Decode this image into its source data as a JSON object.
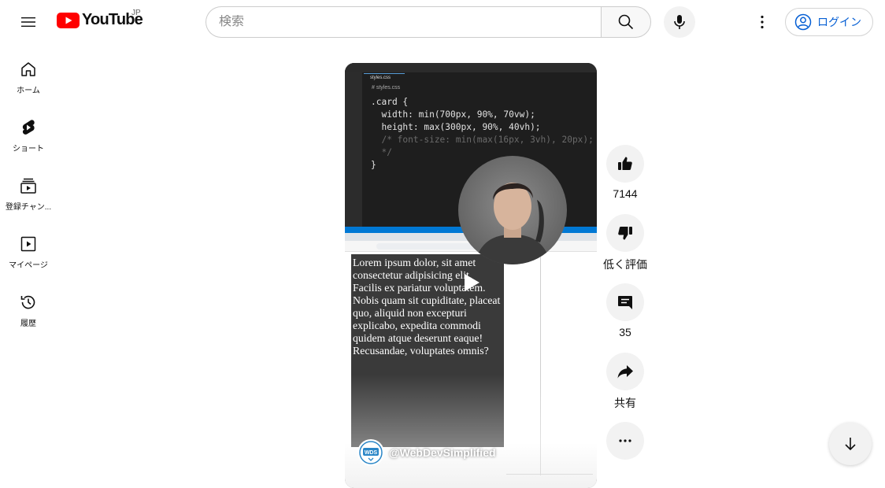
{
  "header": {
    "logo_text": "YouTube",
    "region": "JP",
    "search_placeholder": "検索",
    "login_label": "ログイン"
  },
  "sidebar": {
    "items": [
      {
        "label": "ホーム",
        "icon": "home-icon"
      },
      {
        "label": "ショート",
        "icon": "shorts-icon"
      },
      {
        "label": "登録チャン...",
        "icon": "subscriptions-icon"
      },
      {
        "label": "マイページ",
        "icon": "library-icon"
      },
      {
        "label": "履歴",
        "icon": "history-icon"
      }
    ]
  },
  "short": {
    "editor": {
      "tab_label": "styles.css",
      "breadcrumb": "# styles.css",
      "code_lines": [
        ".card {",
        "  width: min(700px, 90%, 70vw);",
        "  height: max(300px, 90%, 40vh);",
        "  /* font-size: min(max(16px, 3vh), 20px);",
        "  */",
        "}"
      ]
    },
    "card_text": "Lorem ipsum dolor, sit amet consectetur adipisicing elit. Facilis ex pariatur voluptatem. Nobis quam sit cupiditate, placeat quo, aliquid non excepturi explicabo, expedita commodi quidem atque deserunt eaque! Recusandae, voluptates omnis?",
    "channel_handle": "@WebDevSimplified",
    "channel_avatar_text": "WDS"
  },
  "actions": {
    "like_count": "7144",
    "dislike_label": "低く評価",
    "comment_count": "35",
    "share_label": "共有"
  },
  "colors": {
    "brand_red": "#ff0000",
    "link_blue": "#065fd4",
    "chip_gray": "#f2f2f2"
  }
}
